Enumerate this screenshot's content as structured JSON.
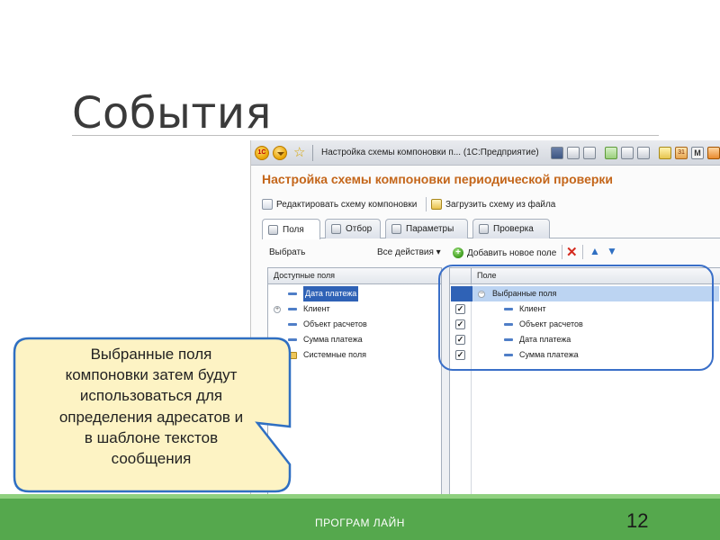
{
  "slide": {
    "title": "События",
    "callout_lines": [
      "Выбранные поля",
      "компоновки затем будут",
      "использоваться для",
      "определения адресатов и",
      "в шаблоне текстов",
      "сообщения"
    ],
    "footer_text": "ПРОГРАМ ЛАЙН",
    "page_number": "12"
  },
  "window": {
    "titlebar_text": "Настройка схемы компоновки п...  (1С:Предприятие)",
    "form_title": "Настройка схемы компоновки периодической проверки",
    "commands": {
      "edit_schema": "Редактировать схему компоновки",
      "load_schema": "Загрузить схему из файла"
    },
    "tabs": [
      "Поля",
      "Отбор",
      "Параметры",
      "Проверка"
    ],
    "active_tab": "Поля",
    "toolbar": {
      "choose": "Выбрать",
      "all_actions": "Все действия",
      "add_field": "Добавить новое поле"
    },
    "available_fields": {
      "header": "Доступные поля",
      "items": [
        "Дата платежа",
        "Клиент",
        "Объект расчетов",
        "Сумма платежа",
        "Системные поля"
      ]
    },
    "selected_fields": {
      "header": "Поле",
      "group": "Выбранные поля",
      "items": [
        "Клиент",
        "Объект расчетов",
        "Дата платежа",
        "Сумма платежа"
      ]
    }
  },
  "colors": {
    "accent_orange": "#c4661a",
    "footer_green": "#55a84d",
    "callout_fill": "#fdf3c4",
    "callout_border": "#2f6fc2",
    "selection_blue": "#2f62b6"
  }
}
